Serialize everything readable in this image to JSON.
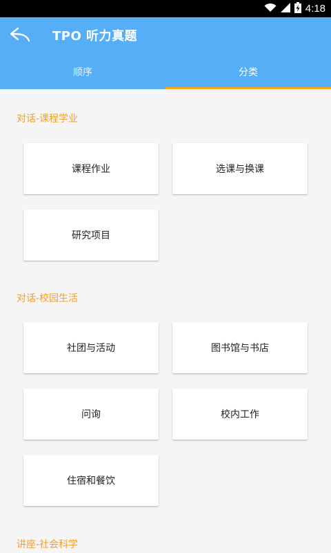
{
  "status_bar": {
    "time": "4:18",
    "icons": [
      "wifi-icon",
      "signal-icon",
      "battery-charging-icon"
    ]
  },
  "app_bar": {
    "title": "TPO 听力真题",
    "back_icon": "back-arrow-icon",
    "background_color": "#55aef6"
  },
  "tabs": [
    {
      "label": "顺序",
      "active": false
    },
    {
      "label": "分类",
      "active": true
    }
  ],
  "accent_color": "#f5a623",
  "sections": [
    {
      "title": "对话-课程学业",
      "items": [
        "课程作业",
        "选课与换课",
        "研究项目"
      ]
    },
    {
      "title": "对话-校园生活",
      "items": [
        "社团与活动",
        "图书馆与书店",
        "问询",
        "校内工作",
        "住宿和餐饮"
      ]
    },
    {
      "title": "讲座-社会科学",
      "items": []
    }
  ]
}
